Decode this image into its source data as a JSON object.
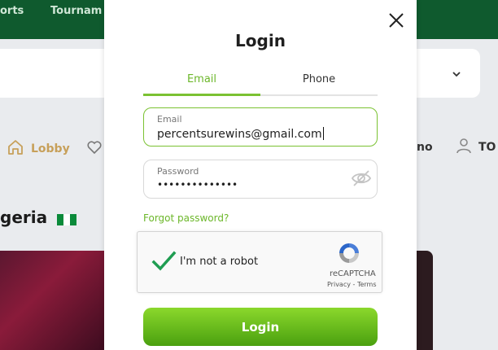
{
  "background": {
    "nav": [
      "orts",
      "Tournam"
    ],
    "lobby_label": "Lobby",
    "right_nav_1": "no",
    "right_nav_2": "TO",
    "heading": "geria"
  },
  "modal": {
    "title": "Login",
    "tabs": [
      {
        "label": "Email",
        "active": true
      },
      {
        "label": "Phone",
        "active": false
      }
    ],
    "email_field": {
      "label": "Email",
      "value": "percentsurewins@gmail.com"
    },
    "password_field": {
      "label": "Password",
      "value": "••••••••••••••"
    },
    "forgot": "Forgot password?",
    "captcha": {
      "label": "I'm not a robot",
      "brand": "reCAPTCHA",
      "links": "Privacy - Terms"
    },
    "submit": "Login"
  },
  "colors": {
    "accent": "#7bc232",
    "dark_green": "#0f5a2e"
  },
  "icons": [
    "close-icon",
    "eye-off-icon",
    "home-icon",
    "heart-icon",
    "user-icon",
    "chevron-down-icon",
    "checkmark-icon",
    "recaptcha-logo-icon"
  ]
}
